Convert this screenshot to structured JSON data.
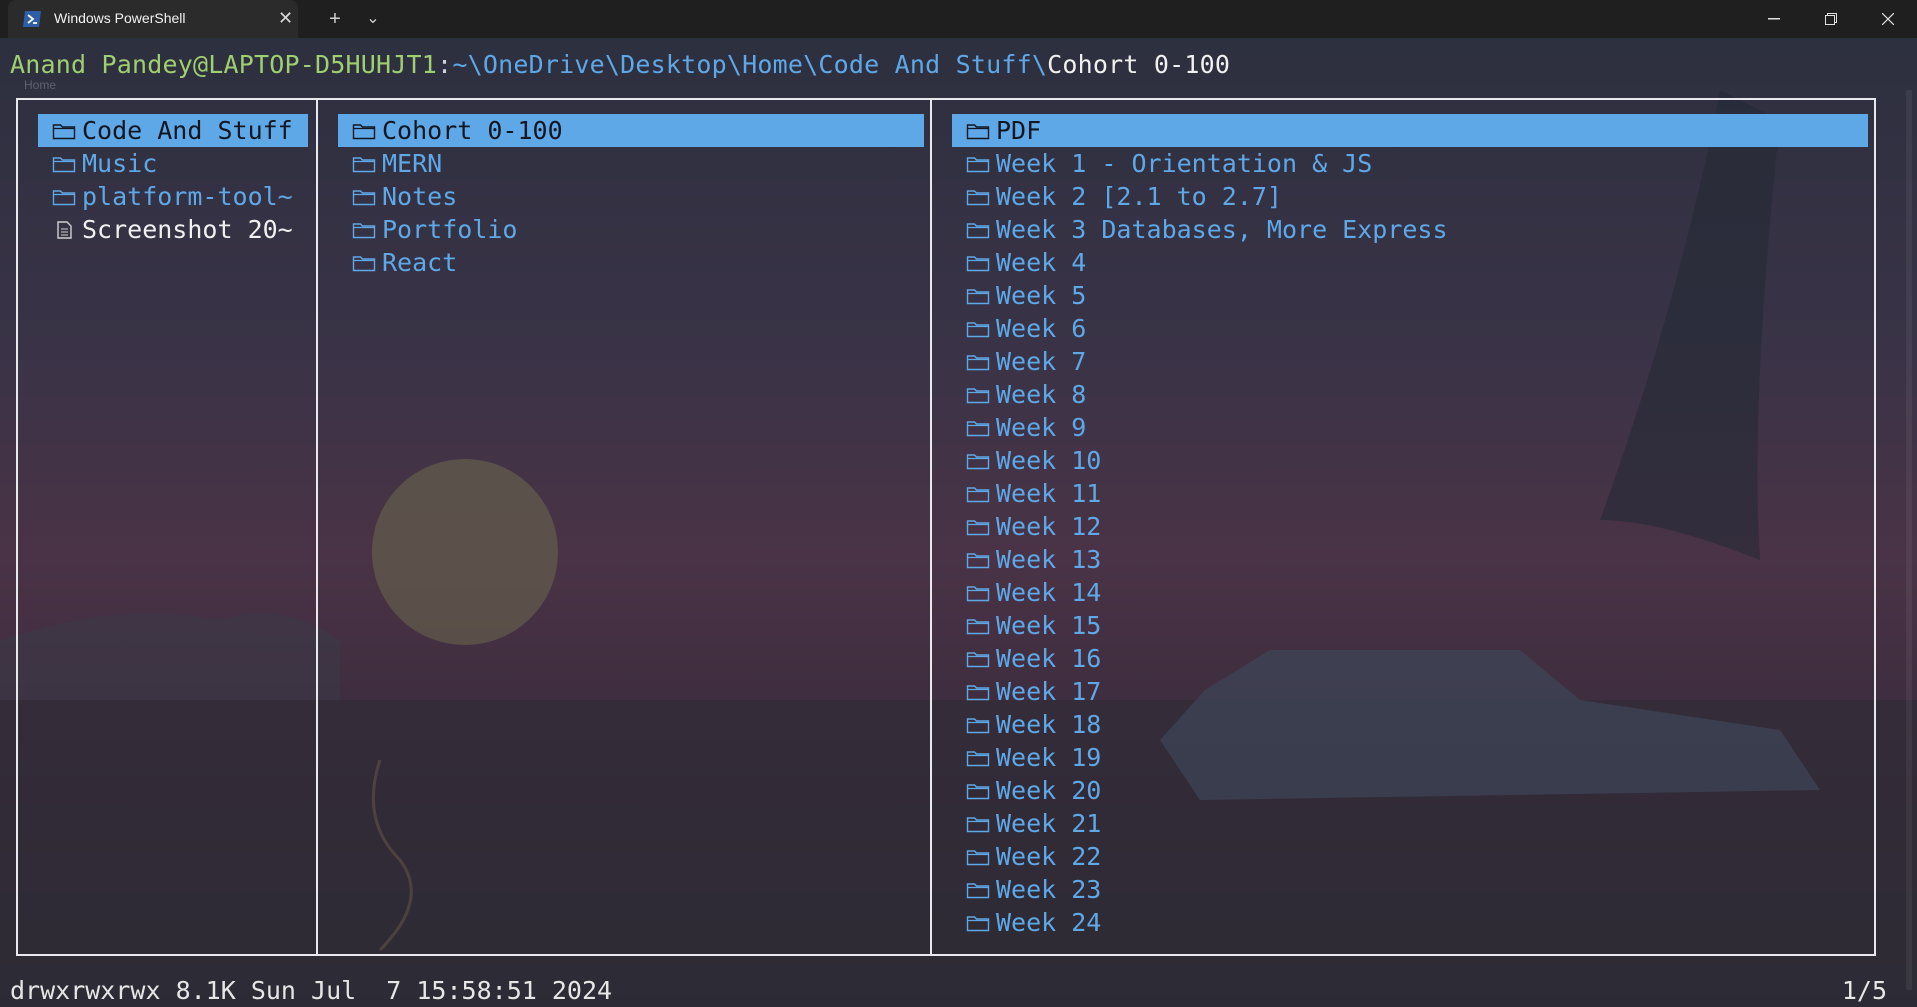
{
  "window": {
    "tab_title": "Windows PowerShell",
    "new_tab": "+",
    "dropdown": "⌄",
    "close_tab": "✕",
    "minimize": "—",
    "restore": "❐",
    "close": "✕"
  },
  "prompt": {
    "user_host": "Anand Pandey@LAPTOP-D5HUHJT1",
    "colon": ":",
    "path": "~\\OneDrive\\Desktop\\Home\\Code And Stuff\\",
    "current": "Cohort 0-100",
    "ghost_label": "Home"
  },
  "columns": {
    "parent": [
      {
        "name": "Code And Stuff",
        "type": "folder",
        "selected": true
      },
      {
        "name": "Music",
        "type": "folder",
        "selected": false
      },
      {
        "name": "platform-tool~",
        "type": "folder",
        "selected": false
      },
      {
        "name": "Screenshot 20~",
        "type": "file",
        "selected": false
      }
    ],
    "current": [
      {
        "name": "Cohort 0-100",
        "type": "folder",
        "selected": true
      },
      {
        "name": "MERN",
        "type": "folder",
        "selected": false
      },
      {
        "name": "Notes",
        "type": "folder",
        "selected": false
      },
      {
        "name": "Portfolio",
        "type": "folder",
        "selected": false
      },
      {
        "name": "React",
        "type": "folder",
        "selected": false
      }
    ],
    "preview": [
      {
        "name": "PDF",
        "type": "folder",
        "selected": true
      },
      {
        "name": "Week 1 - Orientation & JS",
        "type": "folder",
        "selected": false
      },
      {
        "name": "Week 2 [2.1 to 2.7]",
        "type": "folder",
        "selected": false
      },
      {
        "name": "Week 3 Databases, More Express",
        "type": "folder",
        "selected": false
      },
      {
        "name": "Week 4",
        "type": "folder",
        "selected": false
      },
      {
        "name": "Week 5",
        "type": "folder",
        "selected": false
      },
      {
        "name": "Week 6",
        "type": "folder",
        "selected": false
      },
      {
        "name": "Week 7",
        "type": "folder",
        "selected": false
      },
      {
        "name": "Week 8",
        "type": "folder",
        "selected": false
      },
      {
        "name": "Week 9",
        "type": "folder",
        "selected": false
      },
      {
        "name": "Week 10",
        "type": "folder",
        "selected": false
      },
      {
        "name": "Week 11",
        "type": "folder",
        "selected": false
      },
      {
        "name": "Week 12",
        "type": "folder",
        "selected": false
      },
      {
        "name": "Week 13",
        "type": "folder",
        "selected": false
      },
      {
        "name": "Week 14",
        "type": "folder",
        "selected": false
      },
      {
        "name": "Week 15",
        "type": "folder",
        "selected": false
      },
      {
        "name": "Week 16",
        "type": "folder",
        "selected": false
      },
      {
        "name": "Week 17",
        "type": "folder",
        "selected": false
      },
      {
        "name": "Week 18",
        "type": "folder",
        "selected": false
      },
      {
        "name": "Week 19",
        "type": "folder",
        "selected": false
      },
      {
        "name": "Week 20",
        "type": "folder",
        "selected": false
      },
      {
        "name": "Week 21",
        "type": "folder",
        "selected": false
      },
      {
        "name": "Week 22",
        "type": "folder",
        "selected": false
      },
      {
        "name": "Week 23",
        "type": "folder",
        "selected": false
      },
      {
        "name": "Week 24",
        "type": "folder",
        "selected": false
      }
    ]
  },
  "status": {
    "info": "drwxrwxrwx 8.1K Sun Jul  7 15:58:51 2024",
    "position": "1/5"
  },
  "colors": {
    "accent": "#5fa8e8",
    "user": "#9fcf6f",
    "file": "#f0f0f0"
  }
}
